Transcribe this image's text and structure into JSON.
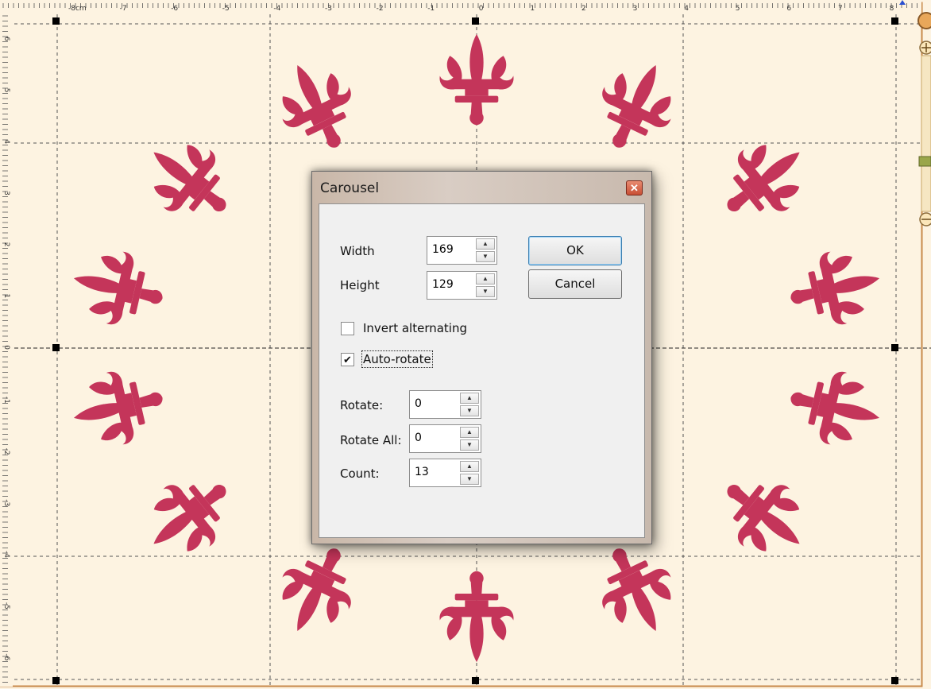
{
  "ruler": {
    "top_labels": [
      "-8cm",
      "-7",
      "-6",
      "-5",
      "-4",
      "-3",
      "-2",
      "-1",
      "0",
      "1",
      "2",
      "3",
      "4",
      "5",
      "6",
      "7",
      "8"
    ],
    "left_labels": [
      "6",
      "5",
      "4",
      "3",
      "2",
      "1",
      "0",
      "-1",
      "-2",
      "-3",
      "-4",
      "-5",
      "-6"
    ]
  },
  "canvas": {
    "motif_color": "#c4355a",
    "motif_count": 14
  },
  "dialog": {
    "title": "Carousel",
    "width_label": "Width",
    "width_value": "169",
    "height_label": "Height",
    "height_value": "129",
    "ok_label": "OK",
    "cancel_label": "Cancel",
    "invert_label": "Invert alternating",
    "invert_checked": false,
    "autorotate_label": "Auto-rotate",
    "autorotate_checked": true,
    "rotate_label": "Rotate:",
    "rotate_value": "0",
    "rotate_all_label": "Rotate All:",
    "rotate_all_value": "0",
    "count_label": "Count:",
    "count_value": "13"
  }
}
